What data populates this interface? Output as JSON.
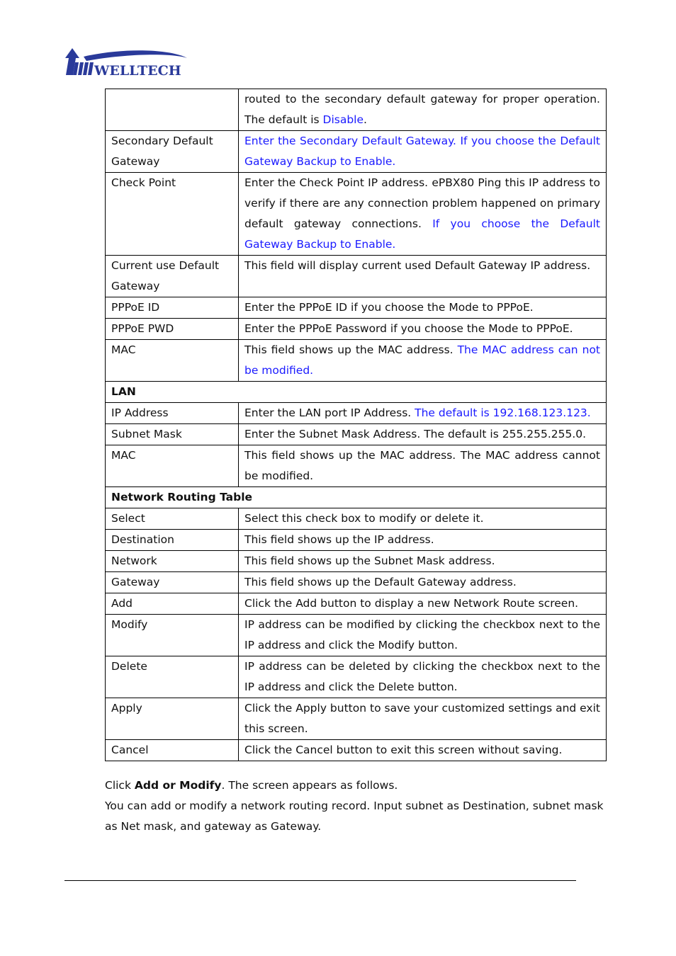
{
  "header": {
    "logo_text": "WELLTECH",
    "logo_icon": "welltech-arrow-logo-icon",
    "brand_color": "#2a3a9a"
  },
  "colors": {
    "text": "#111111",
    "highlight_blue": "#1a1aff",
    "border": "#000000"
  },
  "table": {
    "rows": [
      {
        "type": "row",
        "field": "",
        "desc": [
          {
            "text": "routed to the secondary default gateway for proper operation. The default is "
          },
          {
            "text": "Disable",
            "blue": true
          },
          {
            "text": "."
          }
        ]
      },
      {
        "type": "row",
        "field": "Secondary Default Gateway",
        "desc": [
          {
            "text": "Enter the Secondary Default Gateway. If you choose the Default Gateway Backup to Enable.",
            "blue": true
          }
        ]
      },
      {
        "type": "row",
        "field": "Check Point",
        "desc": [
          {
            "text": "Enter the Check Point IP address. ePBX80 Ping this IP address to verify if there are any connection problem happened on primary default gateway connections. "
          },
          {
            "text": "If you choose the Default Gateway Backup to Enable.",
            "blue": true
          }
        ]
      },
      {
        "type": "row",
        "field": "Current use Default Gateway",
        "desc": [
          {
            "text": "This field will display current used Default Gateway IP address."
          }
        ]
      },
      {
        "type": "row",
        "field": "PPPoE ID",
        "desc": [
          {
            "text": "Enter the PPPoE ID if you choose the Mode to PPPoE."
          }
        ]
      },
      {
        "type": "row",
        "field": "PPPoE PWD",
        "desc": [
          {
            "text": "Enter the PPPoE Password if you choose the Mode to PPPoE."
          }
        ]
      },
      {
        "type": "row",
        "field": "MAC",
        "desc": [
          {
            "text": "This field shows up the MAC address. "
          },
          {
            "text": "The MAC address can not be modified.",
            "blue": true
          }
        ]
      },
      {
        "type": "section",
        "field": "LAN"
      },
      {
        "type": "row",
        "field": "IP Address",
        "desc": [
          {
            "text": "Enter the LAN port IP Address. "
          },
          {
            "text": "The default is 192.168.123.123.",
            "blue": true
          }
        ]
      },
      {
        "type": "row",
        "field": "Subnet Mask",
        "desc": [
          {
            "text": "Enter the Subnet Mask Address. The default is 255.255.255.0."
          }
        ]
      },
      {
        "type": "row",
        "field": "MAC",
        "desc": [
          {
            "text": "This field shows up the MAC address. The MAC address cannot be modified."
          }
        ]
      },
      {
        "type": "section",
        "field": "Network Routing Table"
      },
      {
        "type": "row",
        "field": "Select",
        "desc": [
          {
            "text": "Select this check box to modify or delete it."
          }
        ]
      },
      {
        "type": "row",
        "field": "Destination",
        "desc": [
          {
            "text": "This field shows up the IP address."
          }
        ]
      },
      {
        "type": "row",
        "field": "Network",
        "desc": [
          {
            "text": "This field shows up the Subnet Mask address."
          }
        ]
      },
      {
        "type": "row",
        "field": "Gateway",
        "desc": [
          {
            "text": "This field shows up the Default Gateway address."
          }
        ]
      },
      {
        "type": "row",
        "field": "Add",
        "desc": [
          {
            "text": "Click the Add button to display a new Network Route screen."
          }
        ]
      },
      {
        "type": "row",
        "field": "Modify",
        "desc": [
          {
            "text": "IP address can be modified by clicking the checkbox next to the IP address and click the Modify button."
          }
        ]
      },
      {
        "type": "row",
        "field": "Delete",
        "desc": [
          {
            "text": "IP address can be deleted by clicking the checkbox next to the IP address and click the Delete button."
          }
        ]
      },
      {
        "type": "row",
        "field": "Apply",
        "desc": [
          {
            "text": "Click the Apply button to save your customized settings and exit this screen."
          }
        ]
      },
      {
        "type": "row",
        "field": "Cancel",
        "desc": [
          {
            "text": "Click the Cancel button to exit this screen without saving."
          }
        ]
      }
    ]
  },
  "after_table": {
    "line1_prefix": "Click ",
    "line1_bold": "Add or Modify",
    "line1_suffix": ". The screen appears as follows.",
    "paragraph2": "You can add or modify a network routing record. Input subnet as Destination, subnet mask as Net mask, and gateway as Gateway."
  }
}
